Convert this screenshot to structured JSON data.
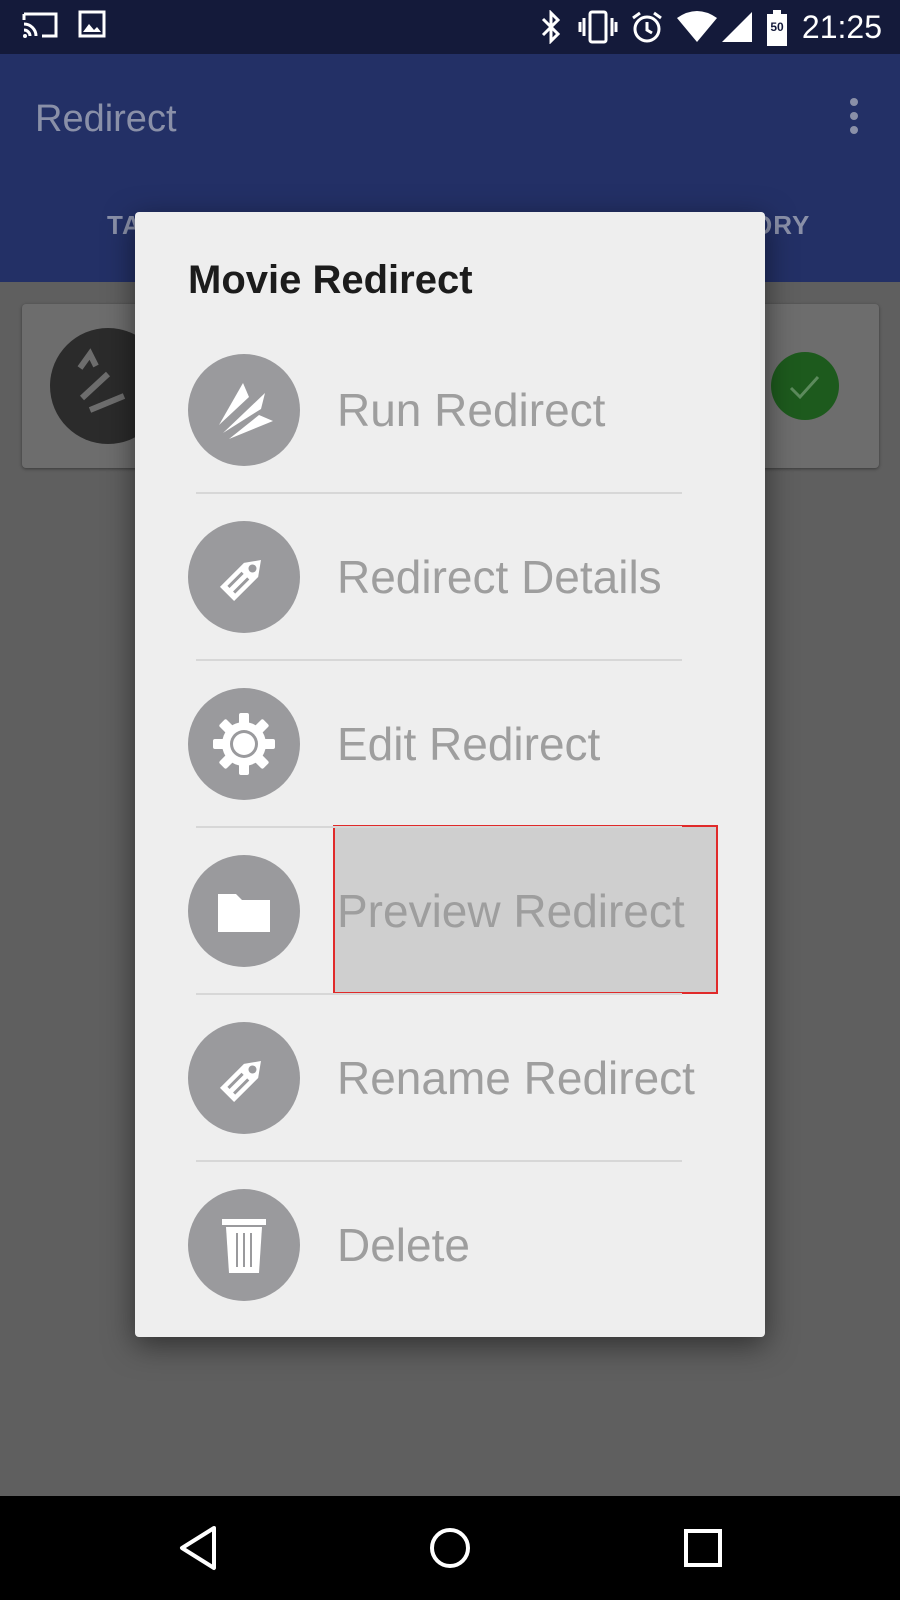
{
  "status_bar": {
    "time": "21:25",
    "battery_level": "50",
    "icons": [
      "cast-icon",
      "image-icon",
      "bluetooth-icon",
      "vibrate-icon",
      "alarm-icon",
      "wifi-icon",
      "signal-icon",
      "battery-icon"
    ]
  },
  "app_bar": {
    "title": "Redirect",
    "tab_left_partial": "TA",
    "tab_right_partial": "ORY"
  },
  "dialog": {
    "title": "Movie Redirect",
    "items": [
      {
        "label": "Run Redirect",
        "icon": "run-redirect-icon"
      },
      {
        "label": "Redirect Details",
        "icon": "tag-icon"
      },
      {
        "label": "Edit Redirect",
        "icon": "gear-icon"
      },
      {
        "label": "Preview Redirect",
        "icon": "folder-icon",
        "highlighted": true
      },
      {
        "label": "Rename Redirect",
        "icon": "tag-icon"
      },
      {
        "label": "Delete",
        "icon": "trash-icon"
      }
    ]
  },
  "colors": {
    "status_bar": "#141a3a",
    "app_bar": "#233066",
    "dialog_bg": "#eeeeee",
    "icon_circle": "#9a9a9d",
    "highlight_border": "#e02a2a",
    "highlight_fill": "#cfcfcf"
  },
  "nav_bar": {
    "buttons": [
      "back-icon",
      "home-icon",
      "recents-icon"
    ]
  }
}
